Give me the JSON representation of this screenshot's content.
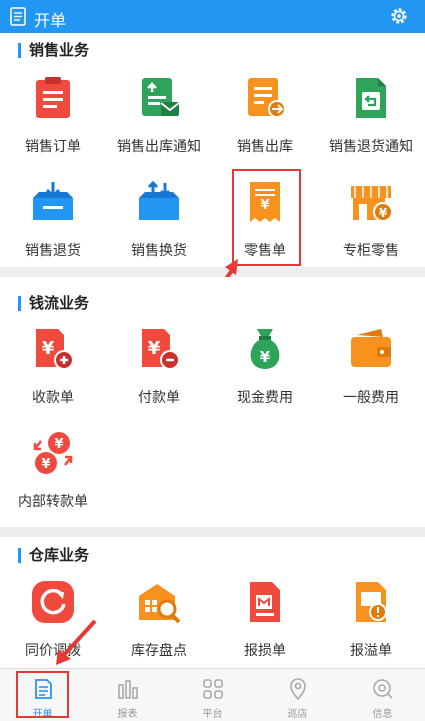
{
  "header": {
    "title": "开单"
  },
  "sections": {
    "sales": {
      "title": "销售业务",
      "items": [
        "销售订单",
        "销售出库通知",
        "销售出库",
        "销售退货通知",
        "销售退货",
        "销售换货",
        "零售单",
        "专柜零售"
      ]
    },
    "cash": {
      "title": "钱流业务",
      "items": [
        "收款单",
        "付款单",
        "现金费用",
        "一般费用",
        "内部转款单"
      ]
    },
    "warehouse": {
      "title": "仓库业务",
      "items": [
        "同价调拨",
        "库存盘点",
        "报损单",
        "报溢单"
      ]
    }
  },
  "tabs": [
    "开单",
    "报表",
    "平台",
    "巡店",
    "信息"
  ],
  "colors": {
    "primary": "#2196f3",
    "red": "#f04a3f",
    "green": "#2ea35a",
    "orange": "#f7921e",
    "highlight": "#e53935"
  }
}
